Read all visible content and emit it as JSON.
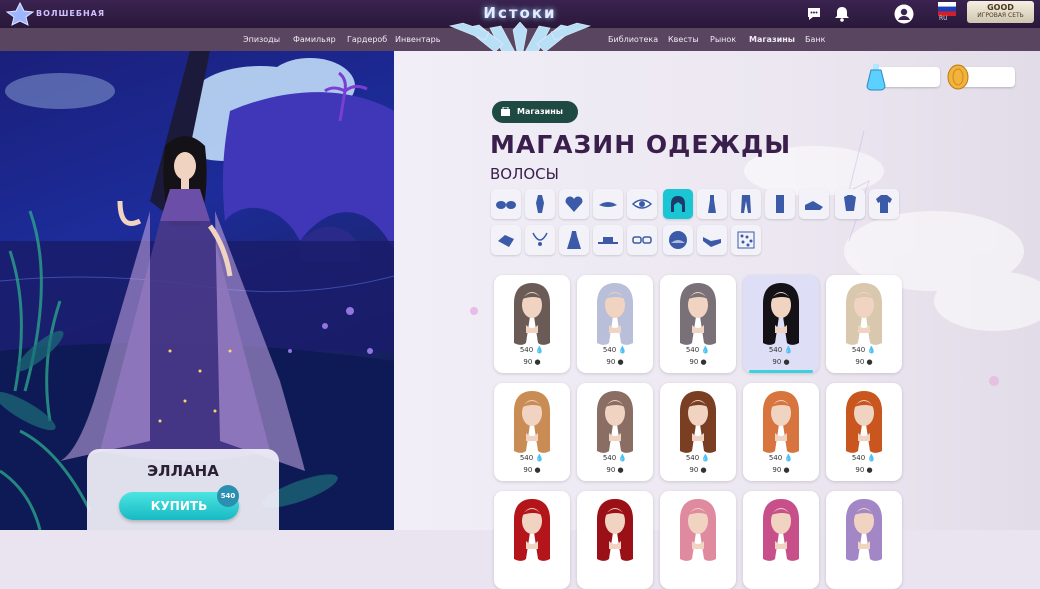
{
  "header": {
    "logo_text": "ВОЛШЕБНАЯ",
    "site_title": "Истоки",
    "language": "RU",
    "network_button": {
      "line1": "GOOD",
      "line2": "ИГРОВАЯ СЕТЬ"
    }
  },
  "nav": {
    "items": [
      {
        "label": "Эпизоды"
      },
      {
        "label": "Фамильяр"
      },
      {
        "label": "Гардероб"
      },
      {
        "label": "Инвентарь"
      },
      {
        "label": "Библиотека"
      },
      {
        "label": "Квесты"
      },
      {
        "label": "Рынок"
      },
      {
        "label": "Магазины",
        "active": true
      },
      {
        "label": "Банк"
      }
    ]
  },
  "shop": {
    "breadcrumb": "Магазины",
    "title": "МАГАЗИН ОДЕЖДЫ",
    "category_title": "ВОЛОСЫ",
    "categories_row1": [
      "glasses-icon",
      "body-icon",
      "heart-top-icon",
      "brim-icon",
      "eye-icon",
      "hair-icon",
      "dress-icon",
      "pants-icon",
      "coat-icon",
      "shoes-icon",
      "top-icon",
      "jacket-icon"
    ],
    "categories_row2": [
      "glove-icon",
      "necklace-icon",
      "gown-icon",
      "hat-icon",
      "spectacles-icon",
      "background-icon",
      "scarf-icon",
      "pattern-icon"
    ],
    "active_category": "hair-icon",
    "currency_crystals": "",
    "currency_coins": ""
  },
  "items": [
    {
      "price_crystal": "540",
      "price_coin": "90",
      "color": "#6a5b57",
      "selected": false
    },
    {
      "price_crystal": "540",
      "price_coin": "90",
      "color": "#b9bfd8",
      "selected": false
    },
    {
      "price_crystal": "540",
      "price_coin": "90",
      "color": "#7a7078",
      "selected": false
    },
    {
      "price_crystal": "540",
      "price_coin": "90",
      "color": "#151217",
      "selected": true
    },
    {
      "price_crystal": "540",
      "price_coin": "90",
      "color": "#d9c7ae",
      "selected": false
    },
    {
      "price_crystal": "540",
      "price_coin": "90",
      "color": "#c98c55",
      "selected": false
    },
    {
      "price_crystal": "540",
      "price_coin": "90",
      "color": "#8a6e64",
      "selected": false
    },
    {
      "price_crystal": "540",
      "price_coin": "90",
      "color": "#7a3e22",
      "selected": false
    },
    {
      "price_crystal": "540",
      "price_coin": "90",
      "color": "#d8743d",
      "selected": false
    },
    {
      "price_crystal": "540",
      "price_coin": "90",
      "color": "#c8561e",
      "selected": false
    },
    {
      "price_crystal": "",
      "price_coin": "",
      "color": "#b3151a",
      "selected": false
    },
    {
      "price_crystal": "",
      "price_coin": "",
      "color": "#9a1016",
      "selected": false
    },
    {
      "price_crystal": "",
      "price_coin": "",
      "color": "#e08aa0",
      "selected": false
    },
    {
      "price_crystal": "",
      "price_coin": "",
      "color": "#c8508a",
      "selected": false
    },
    {
      "price_crystal": "",
      "price_coin": "",
      "color": "#a286c6",
      "selected": false
    }
  ],
  "character": {
    "name": "ЭЛЛАНА",
    "buy_label": "КУПИТЬ",
    "buy_price": "540"
  }
}
